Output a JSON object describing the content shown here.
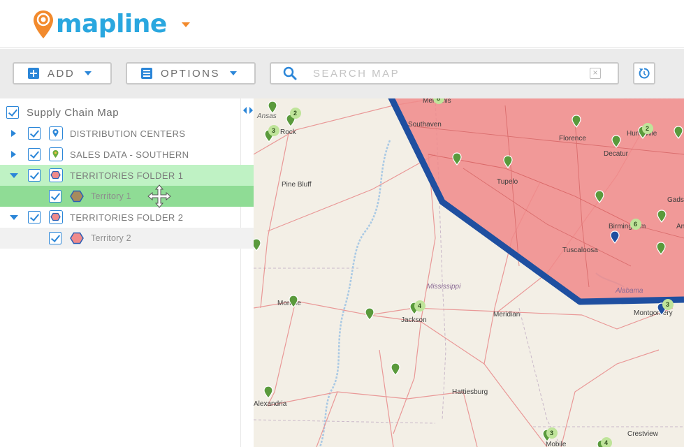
{
  "header": {
    "logo_text": "mapline",
    "colors": {
      "logo_blue": "#2aa7df",
      "logo_orange": "#f28a2d"
    }
  },
  "toolbar": {
    "add_label": "ADD",
    "options_label": "OPTIONS",
    "search_placeholder": "SEARCH MAP",
    "search_value": ""
  },
  "sidebar": {
    "root": {
      "label": "Supply Chain Map",
      "checked": true
    },
    "layers": [
      {
        "label": "DISTRIBUTION CENTERS",
        "checked": true,
        "expanded": false,
        "icon": "marker-blue-icon"
      },
      {
        "label": "SALES DATA - SOUTHERN",
        "checked": true,
        "expanded": false,
        "icon": "marker-green-icon"
      },
      {
        "label": "TERRITORIES FOLDER 1",
        "checked": true,
        "expanded": true,
        "icon": "territory-folder-icon",
        "selected": true
      },
      {
        "label": "Territory 1",
        "checked": true,
        "icon": "territory-hexagon-brown-icon",
        "selected": true
      },
      {
        "label": "TERRITORIES FOLDER 2",
        "checked": true,
        "expanded": true,
        "icon": "territory-folder-icon"
      },
      {
        "label": "Territory 2",
        "checked": true,
        "icon": "territory-hexagon-pink-icon"
      }
    ]
  },
  "map": {
    "state_labels": [
      "Mississippi",
      "Alabama"
    ],
    "cities": [
      "Memphis",
      "Southaven",
      "Rock",
      "Pine Bluff",
      "Tupelo",
      "Florence",
      "Huntsville",
      "Decatur",
      "Birmingham",
      "Gadsden",
      "Tuscaloosa",
      "Monroe",
      "Jackson",
      "Meridian",
      "Montgomery",
      "Alexandria",
      "Hattiesburg",
      "Mobile",
      "Crestview",
      "Ansas",
      "An"
    ],
    "cluster_counts": [
      "8",
      "2",
      "3",
      "2",
      "6",
      "4",
      "3",
      "3",
      "4"
    ],
    "colors": {
      "territory_fill": "#f08a8a",
      "territory_border": "#1f4fa0",
      "marker_green": "#5a9a3c",
      "marker_blue": "#1f4fa0",
      "water": "#a9c9e4"
    }
  }
}
